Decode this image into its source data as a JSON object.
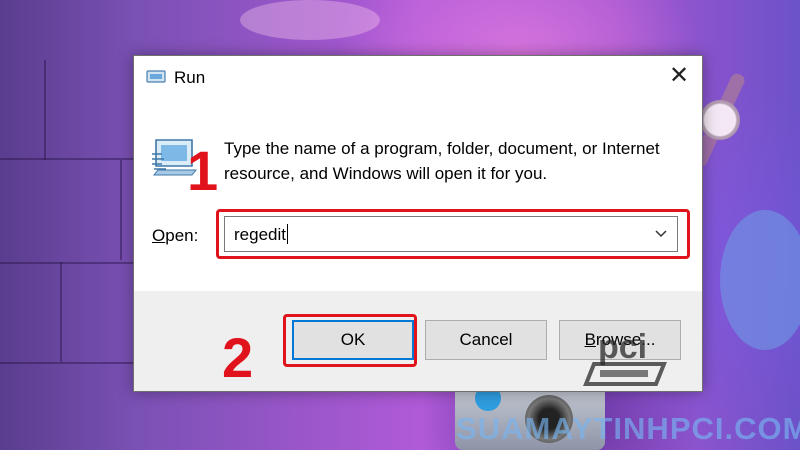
{
  "dialog": {
    "title": "Run",
    "close_glyph": "✕",
    "description": "Type the name of a program, folder, document, or Internet resource, and Windows will open it for you.",
    "open_label_accel": "O",
    "open_label_rest": "pen:",
    "open_value": "regedit",
    "buttons": {
      "ok": "OK",
      "cancel": "Cancel",
      "browse_accel": "B",
      "browse_rest": "rowse..."
    },
    "icons": [
      "run-app-icon",
      "close-icon",
      "dropdown-chevron-icon"
    ]
  },
  "annotations": {
    "step1": "1",
    "step2": "2",
    "color": "#e0131d"
  },
  "watermark": {
    "logo_text": "pci",
    "site": "SUAMAYTINHPCI.COM"
  },
  "colors": {
    "focus_border": "#0078d7",
    "footer_bg": "#efefef"
  }
}
